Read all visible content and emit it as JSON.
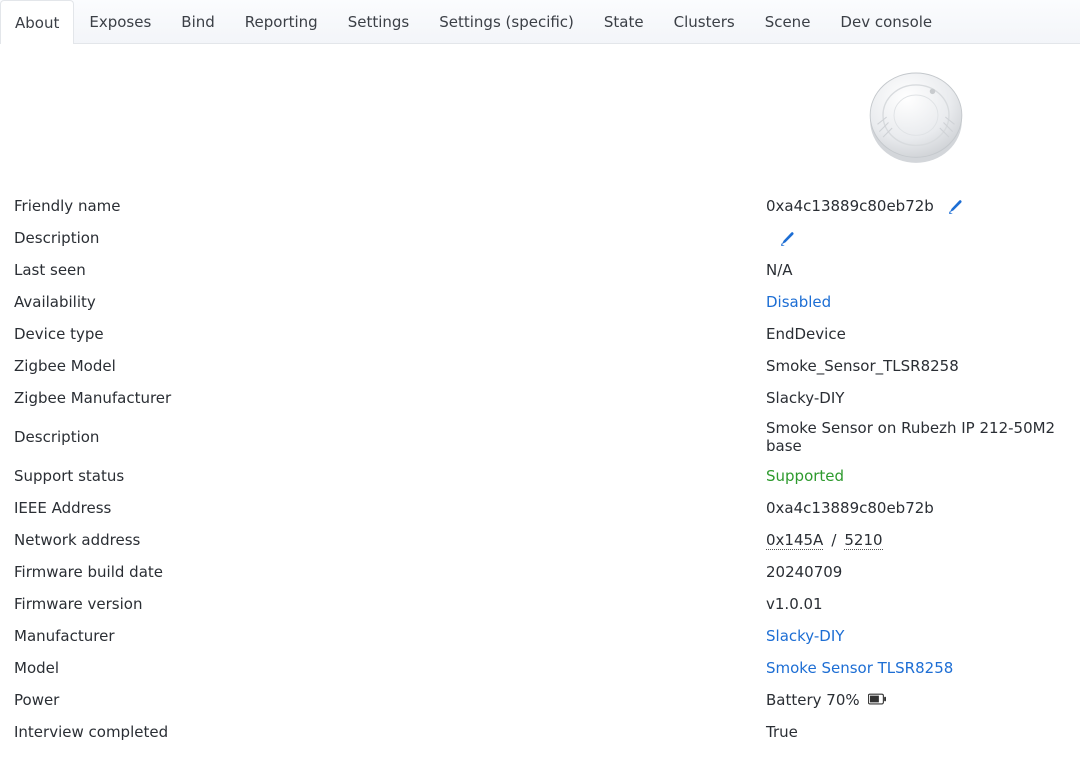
{
  "tabs": [
    {
      "label": "About",
      "active": true
    },
    {
      "label": "Exposes",
      "active": false
    },
    {
      "label": "Bind",
      "active": false
    },
    {
      "label": "Reporting",
      "active": false
    },
    {
      "label": "Settings",
      "active": false
    },
    {
      "label": "Settings (specific)",
      "active": false
    },
    {
      "label": "State",
      "active": false
    },
    {
      "label": "Clusters",
      "active": false
    },
    {
      "label": "Scene",
      "active": false
    },
    {
      "label": "Dev console",
      "active": false
    }
  ],
  "info": {
    "friendly_name": {
      "label": "Friendly name",
      "value": "0xa4c13889c80eb72b"
    },
    "description1": {
      "label": "Description",
      "value": ""
    },
    "last_seen": {
      "label": "Last seen",
      "value": "N/A"
    },
    "availability": {
      "label": "Availability",
      "value": "Disabled"
    },
    "device_type": {
      "label": "Device type",
      "value": "EndDevice"
    },
    "zigbee_model": {
      "label": "Zigbee Model",
      "value": "Smoke_Sensor_TLSR8258"
    },
    "zigbee_manufacturer": {
      "label": "Zigbee Manufacturer",
      "value": "Slacky-DIY"
    },
    "description2": {
      "label": "Description",
      "value": "Smoke Sensor on Rubezh IP 212-50M2 base"
    },
    "support_status": {
      "label": "Support status",
      "value": "Supported"
    },
    "ieee_address": {
      "label": "IEEE Address",
      "value": "0xa4c13889c80eb72b"
    },
    "network_address": {
      "label": "Network address",
      "hex": "0x145A",
      "sep": " / ",
      "dec": "5210"
    },
    "firmware_build_date": {
      "label": "Firmware build date",
      "value": "20240709"
    },
    "firmware_version": {
      "label": "Firmware version",
      "value": "v1.0.01"
    },
    "manufacturer": {
      "label": "Manufacturer",
      "value": "Slacky-DIY"
    },
    "model": {
      "label": "Model",
      "value": "Smoke Sensor TLSR8258"
    },
    "power": {
      "label": "Power",
      "value": "Battery 70%"
    },
    "interview_completed": {
      "label": "Interview completed",
      "value": "True"
    }
  }
}
